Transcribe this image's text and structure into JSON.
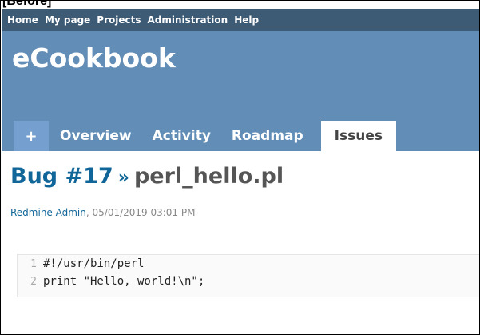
{
  "annotation": "[Before]",
  "top_menu": [
    "Home",
    "My page",
    "Projects",
    "Administration",
    "Help"
  ],
  "project": {
    "title": "eCookbook"
  },
  "tabs": {
    "new": "+",
    "overview": "Overview",
    "activity": "Activity",
    "roadmap": "Roadmap",
    "issues": "Issues"
  },
  "issue": {
    "bug": "Bug #17",
    "separator": "»",
    "name": "perl_hello.pl"
  },
  "author": {
    "name": "Redmine Admin",
    "date": ", 05/01/2019 03:01 PM"
  },
  "code": [
    {
      "n": "1",
      "text": "#!/usr/bin/perl"
    },
    {
      "n": "2",
      "text": "print \"Hello, world!\\n\";"
    }
  ],
  "colors": {
    "topbar": "#3e5b76",
    "header": "#628db6",
    "tab": "#759fcf",
    "link": "#116699"
  }
}
